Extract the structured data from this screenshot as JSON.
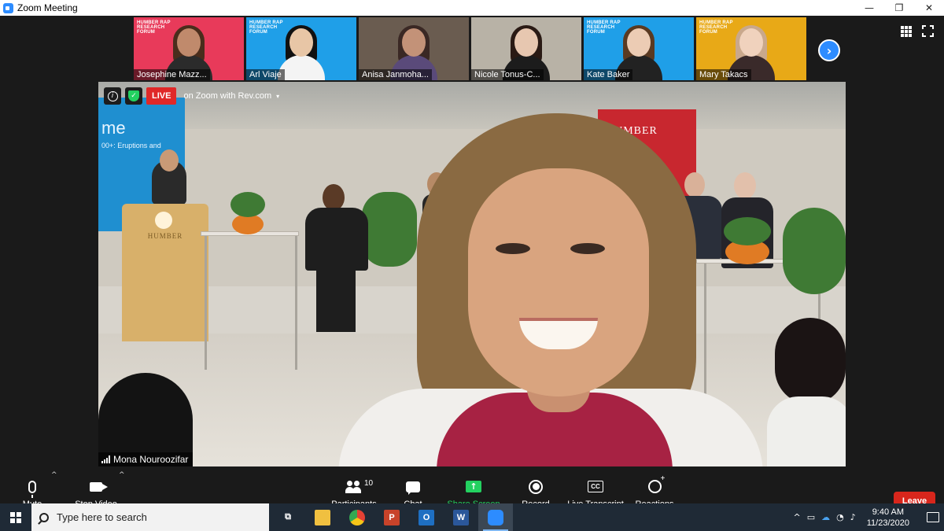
{
  "window": {
    "title": "Zoom Meeting",
    "minimize_glyph": "—",
    "restore_glyph": "❐",
    "close_glyph": "✕"
  },
  "thumbnails": [
    {
      "name": "Josephine Mazz...",
      "bg": "#e83a5a",
      "banner": "HUMBER RAP\nRESEARCH\nFORUM",
      "skin": "#c08a6c",
      "hair": "#4a2d1c",
      "shirt": "#2b2b2b"
    },
    {
      "name": "Arl Viaje",
      "bg": "#1f9fe8",
      "banner": "HUMBER RAP\nRESEARCH\nFORUM",
      "skin": "#e8c6a6",
      "hair": "#111111",
      "shirt": "#f4f4f4"
    },
    {
      "name": "Anisa Janmoha...",
      "bg": "#6a5c50",
      "banner": "",
      "skin": "#c39278",
      "hair": "#3a2824",
      "shirt": "#5a4a7a"
    },
    {
      "name": "Nicole Tonus-C...",
      "bg": "#b8b2a6",
      "banner": "",
      "skin": "#e7c7b0",
      "hair": "#2a1a14",
      "shirt": "#1c1c1c"
    },
    {
      "name": "Kate Baker",
      "bg": "#1f9fe8",
      "banner": "HUMBER RAP\nRESEARCH\nFORUM",
      "skin": "#ecccb4",
      "hair": "#5a3a22",
      "shirt": "#222222"
    },
    {
      "name": "Mary Takacs",
      "bg": "#e8a917",
      "banner": "HUMBER RAP\nRESEARCH\nFORUM",
      "skin": "#f0d2bd",
      "hair": "#c9a88c",
      "shirt": "#3a2a2a"
    }
  ],
  "next_glyph": "›",
  "main": {
    "live_badge": "LIVE",
    "live_label": "on Zoom with Rev.com",
    "live_caret": "▾",
    "info_glyph": "i",
    "shield_glyph": "✓",
    "speaker_name": "Mona Nouroozifar",
    "screen_text": "me",
    "screen_sub": "00+: Eruptions and",
    "banner_text": "HUMBER",
    "podium_text": "HUMBER"
  },
  "controls": {
    "mute": "Mute",
    "stop_video": "Stop Video",
    "participants": "Participants",
    "participants_count": "10",
    "chat": "Chat",
    "share_screen": "Share Screen",
    "share_glyph": "↑",
    "record": "Record",
    "live_transcript": "Live Transcript",
    "cc_glyph": "CC",
    "reactions": "Reactions",
    "leave": "Leave",
    "caret_glyph": "^",
    "share_color": "#23d160",
    "leave_color": "#d8261c"
  },
  "taskbar": {
    "search_placeholder": "Type here to search",
    "apps": [
      {
        "icon": "task-view-icon",
        "glyph": "⧉",
        "bg": "transparent"
      },
      {
        "icon": "file-explorer-icon",
        "glyph": "",
        "bg": "#f0c040"
      },
      {
        "icon": "chrome-icon",
        "glyph": "",
        "bg": "#e44134"
      },
      {
        "icon": "powerpoint-icon",
        "glyph": "P",
        "bg": "#c8432a"
      },
      {
        "icon": "outlook-icon",
        "glyph": "O",
        "bg": "#1e6fc2"
      },
      {
        "icon": "word-icon",
        "glyph": "W",
        "bg": "#2b579a"
      },
      {
        "icon": "zoom-icon",
        "glyph": "",
        "bg": "#2d8cff"
      }
    ],
    "tray_caret": "^",
    "time": "9:40 AM",
    "date": "11/23/2020"
  }
}
